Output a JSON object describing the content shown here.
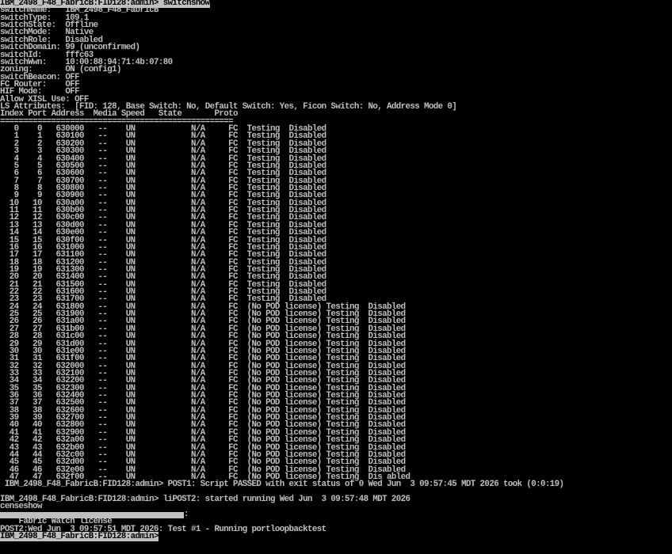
{
  "window": {
    "title": "IBM_2498_F48_FabricB:FID128:admin> switchshow"
  },
  "prompt": "IBM_2498_F48_FabricB:FID128:admin>",
  "command": "switchshow",
  "info": [
    {
      "key": "switchName:",
      "value": "IBM_2498_F48_FabricB"
    },
    {
      "key": "switchType:",
      "value": "109.1"
    },
    {
      "key": "switchState:",
      "value": "Offline"
    },
    {
      "key": "switchMode:",
      "value": "Native"
    },
    {
      "key": "switchRole:",
      "value": "Disabled"
    },
    {
      "key": "switchDomain:",
      "value": "99 (unconfirmed)"
    },
    {
      "key": "switchId:",
      "value": "fffc63"
    },
    {
      "key": "switchWwn:",
      "value": "10:00:88:94:71:4b:07:80"
    },
    {
      "key": "zoning:",
      "value": "ON (config1)"
    },
    {
      "key": "switchBeacon:",
      "value": "OFF"
    },
    {
      "key": "FC Router:",
      "value": "OFF"
    },
    {
      "key": "HIF Mode:",
      "value": "OFF"
    },
    {
      "key": "Allow XISL Use:",
      "value": "OFF"
    },
    {
      "key": "LS Attributes:",
      "value": "[FID: 128, Base Switch: No, Default Switch: Yes, Ficon Switch: No, Address Mode 0]"
    }
  ],
  "table": {
    "header": "Index Port Address  Media Speed   State       Proto",
    "separator": "==================================================",
    "rows": [
      {
        "index": "0",
        "port": "0",
        "address": "630000",
        "media": "--",
        "speed": "UN",
        "state": "N/A",
        "proto": "FC",
        "lic": "",
        "status": "Testing  Disabled"
      },
      {
        "index": "1",
        "port": "1",
        "address": "630100",
        "media": "--",
        "speed": "UN",
        "state": "N/A",
        "proto": "FC",
        "lic": "",
        "status": "Testing  Disabled"
      },
      {
        "index": "2",
        "port": "2",
        "address": "630200",
        "media": "--",
        "speed": "UN",
        "state": "N/A",
        "proto": "FC",
        "lic": "",
        "status": "Testing  Disabled"
      },
      {
        "index": "3",
        "port": "3",
        "address": "630300",
        "media": "--",
        "speed": "UN",
        "state": "N/A",
        "proto": "FC",
        "lic": "",
        "status": "Testing  Disabled"
      },
      {
        "index": "4",
        "port": "4",
        "address": "630400",
        "media": "--",
        "speed": "UN",
        "state": "N/A",
        "proto": "FC",
        "lic": "",
        "status": "Testing  Disabled"
      },
      {
        "index": "5",
        "port": "5",
        "address": "630500",
        "media": "--",
        "speed": "UN",
        "state": "N/A",
        "proto": "FC",
        "lic": "",
        "status": "Testing  Disabled"
      },
      {
        "index": "6",
        "port": "6",
        "address": "630600",
        "media": "--",
        "speed": "UN",
        "state": "N/A",
        "proto": "FC",
        "lic": "",
        "status": "Testing  Disabled"
      },
      {
        "index": "7",
        "port": "7",
        "address": "630700",
        "media": "--",
        "speed": "UN",
        "state": "N/A",
        "proto": "FC",
        "lic": "",
        "status": "Testing  Disabled"
      },
      {
        "index": "8",
        "port": "8",
        "address": "630800",
        "media": "--",
        "speed": "UN",
        "state": "N/A",
        "proto": "FC",
        "lic": "",
        "status": "Testing  Disabled"
      },
      {
        "index": "9",
        "port": "9",
        "address": "630900",
        "media": "--",
        "speed": "UN",
        "state": "N/A",
        "proto": "FC",
        "lic": "",
        "status": "Testing  Disabled"
      },
      {
        "index": "10",
        "port": "10",
        "address": "630a00",
        "media": "--",
        "speed": "UN",
        "state": "N/A",
        "proto": "FC",
        "lic": "",
        "status": "Testing  Disabled"
      },
      {
        "index": "11",
        "port": "11",
        "address": "630b00",
        "media": "--",
        "speed": "UN",
        "state": "N/A",
        "proto": "FC",
        "lic": "",
        "status": "Testing  Disabled"
      },
      {
        "index": "12",
        "port": "12",
        "address": "630c00",
        "media": "--",
        "speed": "UN",
        "state": "N/A",
        "proto": "FC",
        "lic": "",
        "status": "Testing  Disabled"
      },
      {
        "index": "13",
        "port": "13",
        "address": "630d00",
        "media": "--",
        "speed": "UN",
        "state": "N/A",
        "proto": "FC",
        "lic": "",
        "status": "Testing  Disabled"
      },
      {
        "index": "14",
        "port": "14",
        "address": "630e00",
        "media": "--",
        "speed": "UN",
        "state": "N/A",
        "proto": "FC",
        "lic": "",
        "status": "Testing  Disabled"
      },
      {
        "index": "15",
        "port": "15",
        "address": "630f00",
        "media": "--",
        "speed": "UN",
        "state": "N/A",
        "proto": "FC",
        "lic": "",
        "status": "Testing  Disabled"
      },
      {
        "index": "16",
        "port": "16",
        "address": "631000",
        "media": "--",
        "speed": "UN",
        "state": "N/A",
        "proto": "FC",
        "lic": "",
        "status": "Testing  Disabled"
      },
      {
        "index": "17",
        "port": "17",
        "address": "631100",
        "media": "--",
        "speed": "UN",
        "state": "N/A",
        "proto": "FC",
        "lic": "",
        "status": "Testing  Disabled"
      },
      {
        "index": "18",
        "port": "18",
        "address": "631200",
        "media": "--",
        "speed": "UN",
        "state": "N/A",
        "proto": "FC",
        "lic": "",
        "status": "Testing  Disabled"
      },
      {
        "index": "19",
        "port": "19",
        "address": "631300",
        "media": "--",
        "speed": "UN",
        "state": "N/A",
        "proto": "FC",
        "lic": "",
        "status": "Testing  Disabled"
      },
      {
        "index": "20",
        "port": "20",
        "address": "631400",
        "media": "--",
        "speed": "UN",
        "state": "N/A",
        "proto": "FC",
        "lic": "",
        "status": "Testing  Disabled"
      },
      {
        "index": "21",
        "port": "21",
        "address": "631500",
        "media": "--",
        "speed": "UN",
        "state": "N/A",
        "proto": "FC",
        "lic": "",
        "status": "Testing  Disabled"
      },
      {
        "index": "22",
        "port": "22",
        "address": "631600",
        "media": "--",
        "speed": "UN",
        "state": "N/A",
        "proto": "FC",
        "lic": "",
        "status": "Testing  Disabled"
      },
      {
        "index": "23",
        "port": "23",
        "address": "631700",
        "media": "--",
        "speed": "UN",
        "state": "N/A",
        "proto": "FC",
        "lic": "",
        "status": "Testing  Disabled"
      },
      {
        "index": "24",
        "port": "24",
        "address": "631800",
        "media": "--",
        "speed": "UN",
        "state": "N/A",
        "proto": "FC",
        "lic": "(No POD license)",
        "status": "Testing  Disabled"
      },
      {
        "index": "25",
        "port": "25",
        "address": "631900",
        "media": "--",
        "speed": "UN",
        "state": "N/A",
        "proto": "FC",
        "lic": "(No POD license)",
        "status": "Testing  Disabled"
      },
      {
        "index": "26",
        "port": "26",
        "address": "631a00",
        "media": "--",
        "speed": "UN",
        "state": "N/A",
        "proto": "FC",
        "lic": "(No POD license)",
        "status": "Testing  Disabled"
      },
      {
        "index": "27",
        "port": "27",
        "address": "631b00",
        "media": "--",
        "speed": "UN",
        "state": "N/A",
        "proto": "FC",
        "lic": "(No POD license)",
        "status": "Testing  Disabled"
      },
      {
        "index": "28",
        "port": "28",
        "address": "631c00",
        "media": "--",
        "speed": "UN",
        "state": "N/A",
        "proto": "FC",
        "lic": "(No POD license)",
        "status": "Testing  Disabled"
      },
      {
        "index": "29",
        "port": "29",
        "address": "631d00",
        "media": "--",
        "speed": "UN",
        "state": "N/A",
        "proto": "FC",
        "lic": "(No POD license)",
        "status": "Testing  Disabled"
      },
      {
        "index": "30",
        "port": "30",
        "address": "631e00",
        "media": "--",
        "speed": "UN",
        "state": "N/A",
        "proto": "FC",
        "lic": "(No POD license)",
        "status": "Testing  Disabled"
      },
      {
        "index": "31",
        "port": "31",
        "address": "631f00",
        "media": "--",
        "speed": "UN",
        "state": "N/A",
        "proto": "FC",
        "lic": "(No POD license)",
        "status": "Testing  Disabled"
      },
      {
        "index": "32",
        "port": "32",
        "address": "632000",
        "media": "--",
        "speed": "UN",
        "state": "N/A",
        "proto": "FC",
        "lic": "(No POD license)",
        "status": "Testing  Disabled"
      },
      {
        "index": "33",
        "port": "33",
        "address": "632100",
        "media": "--",
        "speed": "UN",
        "state": "N/A",
        "proto": "FC",
        "lic": "(No POD license)",
        "status": "Testing  Disabled"
      },
      {
        "index": "34",
        "port": "34",
        "address": "632200",
        "media": "--",
        "speed": "UN",
        "state": "N/A",
        "proto": "FC",
        "lic": "(No POD license)",
        "status": "Testing  Disabled"
      },
      {
        "index": "35",
        "port": "35",
        "address": "632300",
        "media": "--",
        "speed": "UN",
        "state": "N/A",
        "proto": "FC",
        "lic": "(No POD license)",
        "status": "Testing  Disabled"
      },
      {
        "index": "36",
        "port": "36",
        "address": "632400",
        "media": "--",
        "speed": "UN",
        "state": "N/A",
        "proto": "FC",
        "lic": "(No POD license)",
        "status": "Testing  Disabled"
      },
      {
        "index": "37",
        "port": "37",
        "address": "632500",
        "media": "--",
        "speed": "UN",
        "state": "N/A",
        "proto": "FC",
        "lic": "(No POD license)",
        "status": "Testing  Disabled"
      },
      {
        "index": "38",
        "port": "38",
        "address": "632600",
        "media": "--",
        "speed": "UN",
        "state": "N/A",
        "proto": "FC",
        "lic": "(No POD license)",
        "status": "Testing  Disabled"
      },
      {
        "index": "39",
        "port": "39",
        "address": "632700",
        "media": "--",
        "speed": "UN",
        "state": "N/A",
        "proto": "FC",
        "lic": "(No POD license)",
        "status": "Testing  Disabled"
      },
      {
        "index": "40",
        "port": "40",
        "address": "632800",
        "media": "--",
        "speed": "UN",
        "state": "N/A",
        "proto": "FC",
        "lic": "(No POD license)",
        "status": "Testing  Disabled"
      },
      {
        "index": "41",
        "port": "41",
        "address": "632900",
        "media": "--",
        "speed": "UN",
        "state": "N/A",
        "proto": "FC",
        "lic": "(No POD license)",
        "status": "Testing  Disabled"
      },
      {
        "index": "42",
        "port": "42",
        "address": "632a00",
        "media": "--",
        "speed": "UN",
        "state": "N/A",
        "proto": "FC",
        "lic": "(No POD license)",
        "status": "Testing  Disabled"
      },
      {
        "index": "43",
        "port": "43",
        "address": "632b00",
        "media": "--",
        "speed": "UN",
        "state": "N/A",
        "proto": "FC",
        "lic": "(No POD license)",
        "status": "Testing  Disabled"
      },
      {
        "index": "44",
        "port": "44",
        "address": "632c00",
        "media": "--",
        "speed": "UN",
        "state": "N/A",
        "proto": "FC",
        "lic": "(No POD license)",
        "status": "Testing  Disabled"
      },
      {
        "index": "45",
        "port": "45",
        "address": "632d00",
        "media": "--",
        "speed": "UN",
        "state": "N/A",
        "proto": "FC",
        "lic": "(No POD license)",
        "status": "Testing  Disabled"
      },
      {
        "index": "46",
        "port": "46",
        "address": "632e00",
        "media": "--",
        "speed": "UN",
        "state": "N/A",
        "proto": "FC",
        "lic": "(No POD license)",
        "status": "Testing  Disabled"
      },
      {
        "index": "47",
        "port": "47",
        "address": "632f00",
        "media": "--",
        "speed": "UN",
        "state": "N/A",
        "proto": "FC",
        "lic": "(No POD license)",
        "status": "Testing  Dis abled"
      }
    ]
  },
  "tail": [
    " IBM_2498_F48_FabricB:FID128:admin> POST1: Script PASSED with exit status of 0 Wed Jun  3 09:57:45 MDT 2026 took (0:0:19)",
    "",
    "IBM_2498_F48_FabricB:FID128:admin> liPOST2: started running Wed Jun  3 09:57:48 MDT 2026",
    "censeshow"
  ],
  "redacted_suffix": ":",
  "license_line": "    Fabric Watch license",
  "post_line": "POST2:Wed Jun  3 09:57:51 MDT 2026: Test #1 - Running portloopbacktest",
  "final_prompt": "IBM_2498_F48_FabricB:FID128:admin>",
  "colors": {
    "background": "#000000",
    "text": "#c0c0c0",
    "highlight": "#c0c0c0"
  }
}
